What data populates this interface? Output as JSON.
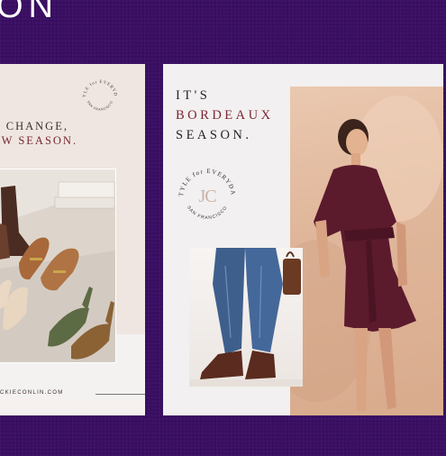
{
  "banner": {
    "heading": "ON"
  },
  "left_card": {
    "seal": {
      "arc_text": "STYLE for EVERYDAY",
      "bottom_text": "SAN FRANCISCO"
    },
    "tagline_line1": "E CHANGE,",
    "tagline_line2": "EW SEASON.",
    "website": "CKIECONLIN.COM"
  },
  "right_card": {
    "title_line1": "IT'S",
    "title_line2": "BORDEAUX",
    "title_line3": "SEASON.",
    "seal": {
      "arc_text": "STYLE for EVERYDAY",
      "monogram": "JC",
      "bottom_text": "SAN FRANCISCO"
    }
  },
  "colors": {
    "background": "#3a0f63",
    "accent_bordeaux": "#7a2432",
    "card": "#efe6e1"
  }
}
